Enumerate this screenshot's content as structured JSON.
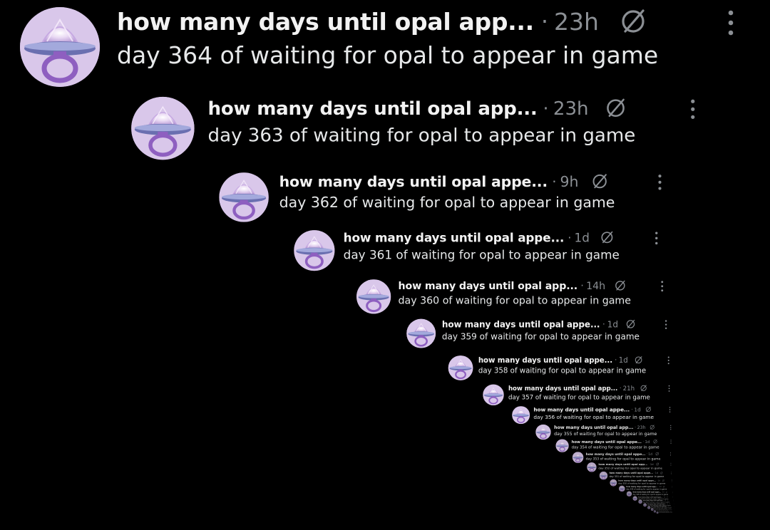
{
  "posts": [
    {
      "title": "how many days until opal app...",
      "time": "23h",
      "text": "day 364 of waiting for opal to appear in game"
    },
    {
      "title": "how many days until opal app...",
      "time": "23h",
      "text": "day 363 of waiting for opal to appear in game"
    },
    {
      "title": "how many days until opal appe...",
      "time": "9h",
      "text": "day 362 of waiting for opal to appear in game"
    },
    {
      "title": "how many days until opal appe...",
      "time": "1d",
      "text": "day 361 of waiting for opal to appear in game"
    },
    {
      "title": "how many days until opal app...",
      "time": "14h",
      "text": "day 360 of waiting for opal to appear in game"
    },
    {
      "title": "how many days until opal appe...",
      "time": "1d",
      "text": "day 359 of waiting for opal to appear in game"
    },
    {
      "title": "how many days until opal appe...",
      "time": "1d",
      "text": "day 358 of waiting for opal to appear in game"
    },
    {
      "title": "how many days until opal app...",
      "time": "21h",
      "text": "day 357 of waiting for opal to appear in game"
    },
    {
      "title": "how many days until opal appe...",
      "time": "1d",
      "text": "day 356 of waiting for opal to appear in game"
    },
    {
      "title": "how many days until opal app...",
      "time": "23h",
      "text": "day 355 of waiting for opal to appear in game"
    },
    {
      "title": "how many days until opal appe...",
      "time": "1d",
      "text": "day 354 of waiting for opal to appear in game"
    },
    {
      "title": "how many days until opal appe...",
      "time": "1d",
      "text": "day 353 of waiting for opal to appear in game"
    },
    {
      "title": "how many days until opal app...",
      "time": "1d",
      "text": "day 352 of waiting for opal to appear in game"
    },
    {
      "title": "how many days until opal appe...",
      "time": "1d",
      "text": "day 351 of waiting for opal to appear in game"
    },
    {
      "title": "how many days until opal appe...",
      "time": "1d",
      "text": "day 350 of waiting for opal to appear in game"
    },
    {
      "title": "how many days until opal app...",
      "time": "1d",
      "text": "day 349 of waiting for opal to appear in game"
    },
    {
      "title": "how many days until opal appe...",
      "time": "1d",
      "text": "day 348 of waiting for opal to appear in game"
    },
    {
      "title": "how many days until opal appe...",
      "time": "1d",
      "text": "day 347 of waiting for opal to appear in game"
    },
    {
      "title": "how many days until opal app...",
      "time": "1d",
      "text": "day 346 of waiting for opal to appear in game"
    },
    {
      "title": "how many days until opal appe...",
      "time": "1d",
      "text": "day 345 of waiting for opal to appear in game"
    },
    {
      "title": "how many days until opal appe...",
      "time": "1d",
      "text": "day 344 of waiting for opal to appear in game"
    },
    {
      "title": "how many days until opal app...",
      "time": "1d",
      "text": "day 343 of waiting for opal to appear in game"
    },
    {
      "title": "how many days until opal appe...",
      "time": "1d",
      "text": "day 342 of waiting for opal to appear in game"
    },
    {
      "title": "how many days until opal appe...",
      "time": "1d",
      "text": "day 341 of waiting for opal to appear in game"
    }
  ],
  "separator": "·",
  "icons": {
    "grok": "grok-icon",
    "more": "more-icon",
    "avatar": "opal-pacifier-avatar"
  },
  "colors": {
    "background": "#000000",
    "text": "#e7e9ea",
    "muted": "#8b8f94",
    "avatar_purple": "#8e5fc0"
  }
}
